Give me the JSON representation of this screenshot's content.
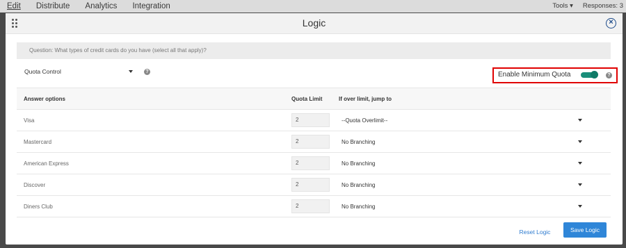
{
  "topbar": {
    "nav": [
      "Edit",
      "Distribute",
      "Analytics",
      "Integration"
    ],
    "tools": "Tools ▾",
    "responses": "Responses: 3"
  },
  "modal": {
    "title": "Logic",
    "close_icon": "close-circle-icon",
    "question": "Question: What types of credit cards do you have (select all that apply)?",
    "quota_control": "Quota Control",
    "min_quota_label": "Enable Minimum Quota",
    "min_quota_enabled": true,
    "table": {
      "headers": [
        "Answer options",
        "Quota Limit",
        "If over limit, jump to"
      ],
      "rows": [
        {
          "answer": "Visa",
          "limit": "2",
          "jump": "--Quota Overlimit--"
        },
        {
          "answer": "Mastercard",
          "limit": "2",
          "jump": "No Branching"
        },
        {
          "answer": "American Express",
          "limit": "2",
          "jump": "No Branching"
        },
        {
          "answer": "Discover",
          "limit": "2",
          "jump": "No Branching"
        },
        {
          "answer": "Diners Club",
          "limit": "2",
          "jump": "No Branching"
        }
      ]
    },
    "reset_label": "Reset Logic",
    "save_label": "Save Logic"
  },
  "colors": {
    "accent": "#2f86d8",
    "toggle": "#1a8e7a",
    "highlight": "#e00000"
  }
}
